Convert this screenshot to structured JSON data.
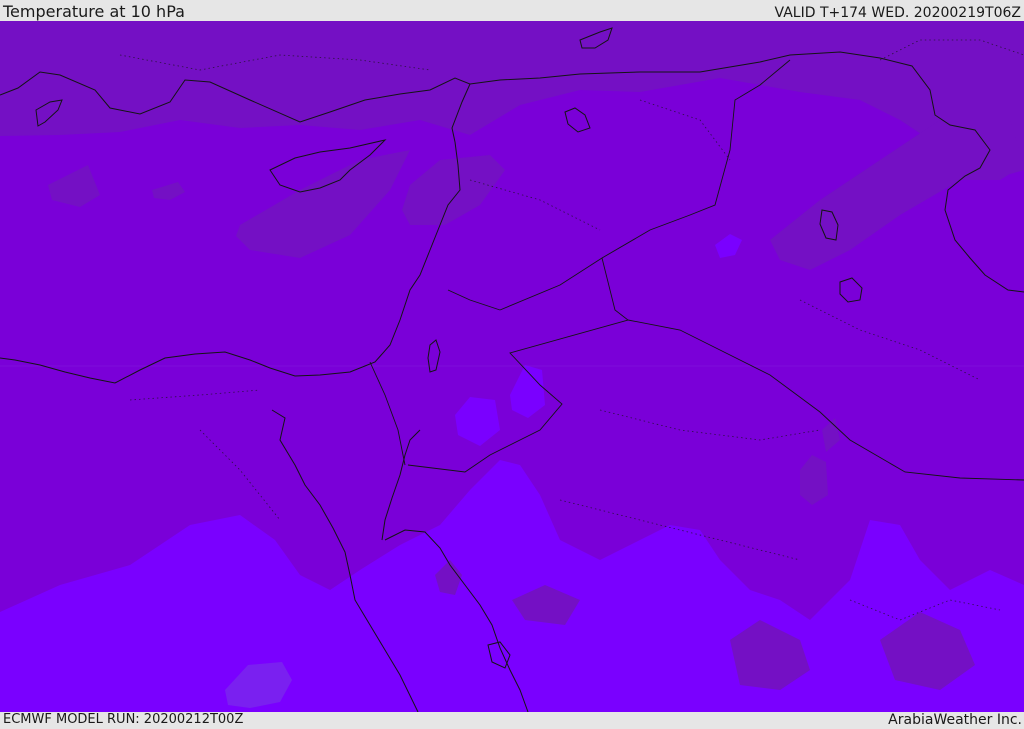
{
  "header": {
    "title": "Temperature at 10 hPa",
    "valid_time": "VALID T+174 WED. 20200219T06Z"
  },
  "footer": {
    "model_run": "ECMWF MODEL RUN: 20200212T00Z",
    "credit": "ArabiaWeather Inc."
  },
  "map": {
    "field": "temperature",
    "pressure_level": "10 hPa",
    "colors": {
      "background": "#7a00d8",
      "cold_band": "#7410c4",
      "warm_band": "#7a00ff",
      "warm_core": "#7a20f0",
      "coastline": "#141414",
      "frame": "#e6e6e6"
    }
  }
}
